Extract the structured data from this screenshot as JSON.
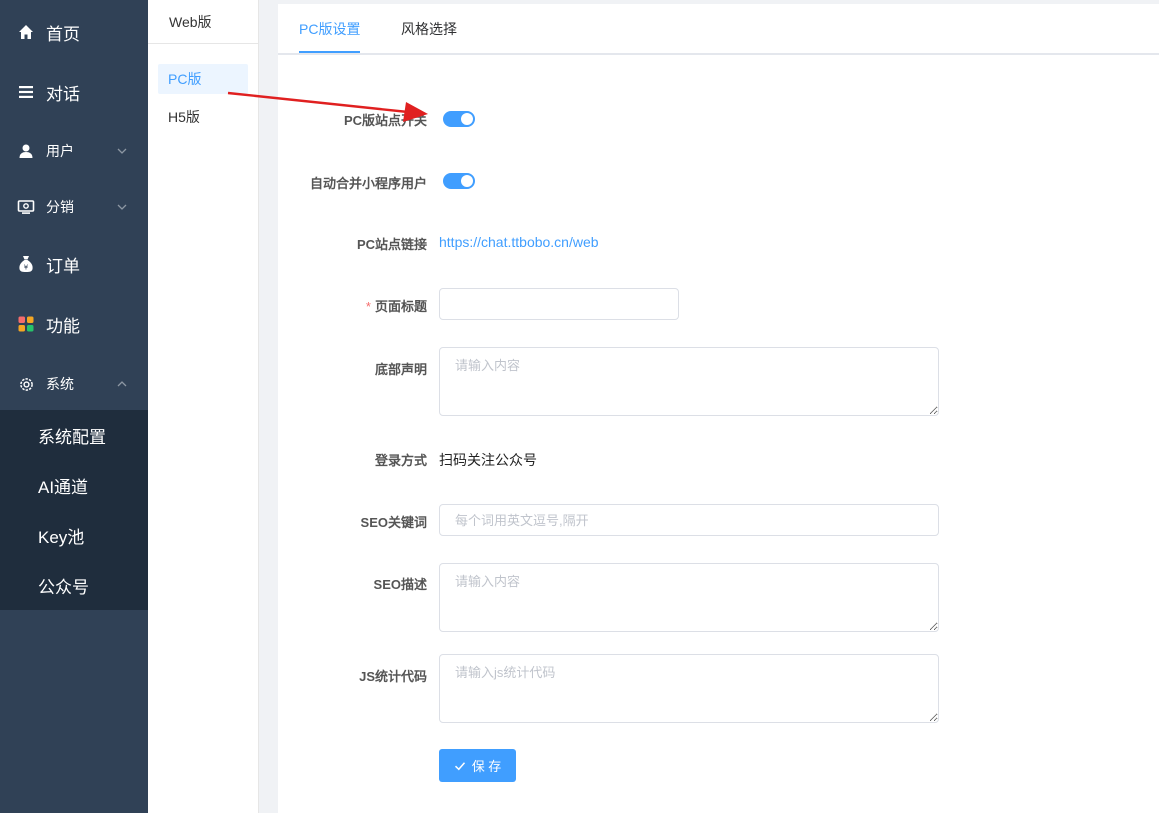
{
  "sidebar": {
    "items": [
      {
        "label": "首页",
        "icon": "home-icon"
      },
      {
        "label": "对话",
        "icon": "list-icon"
      },
      {
        "label": "用户",
        "icon": "user-icon"
      },
      {
        "label": "分销",
        "icon": "distribution-icon"
      },
      {
        "label": "订单",
        "icon": "money-bag-icon"
      },
      {
        "label": "功能",
        "icon": "apps-grid-icon"
      },
      {
        "label": "系统",
        "icon": "gear-icon"
      }
    ],
    "system_submenu": [
      "系统配置",
      "AI通道",
      "Key池",
      "公众号"
    ]
  },
  "panel2": {
    "title": "Web版",
    "items": [
      {
        "label": "PC版"
      },
      {
        "label": "H5版"
      }
    ]
  },
  "tabs": [
    {
      "label": "PC版设置"
    },
    {
      "label": "风格选择"
    }
  ],
  "form": {
    "pc_site_switch": {
      "label": "PC版站点开关",
      "value": true
    },
    "merge_mini_users": {
      "label": "自动合并小程序用户",
      "value": true
    },
    "pc_site_link": {
      "label": "PC站点链接",
      "value": "https://chat.ttbobo.cn/web"
    },
    "page_title": {
      "label": "页面标题",
      "required_mark": "*",
      "value": "",
      "placeholder": ""
    },
    "footer_statement": {
      "label": "底部声明",
      "placeholder": "请输入内容"
    },
    "login_method": {
      "label": "登录方式",
      "value": "扫码关注公众号"
    },
    "seo_keywords": {
      "label": "SEO关键词",
      "placeholder": "每个词用英文逗号,隔开"
    },
    "seo_description": {
      "label": "SEO描述",
      "placeholder": "请输入内容"
    },
    "js_stats_code": {
      "label": "JS统计代码",
      "placeholder": "请输入js统计代码"
    },
    "save_label": "保 存"
  },
  "colors": {
    "primary": "#409eff",
    "sidebar_bg": "#304156",
    "submenu_bg": "#1f2d3d",
    "annotation_arrow": "#e02020"
  }
}
